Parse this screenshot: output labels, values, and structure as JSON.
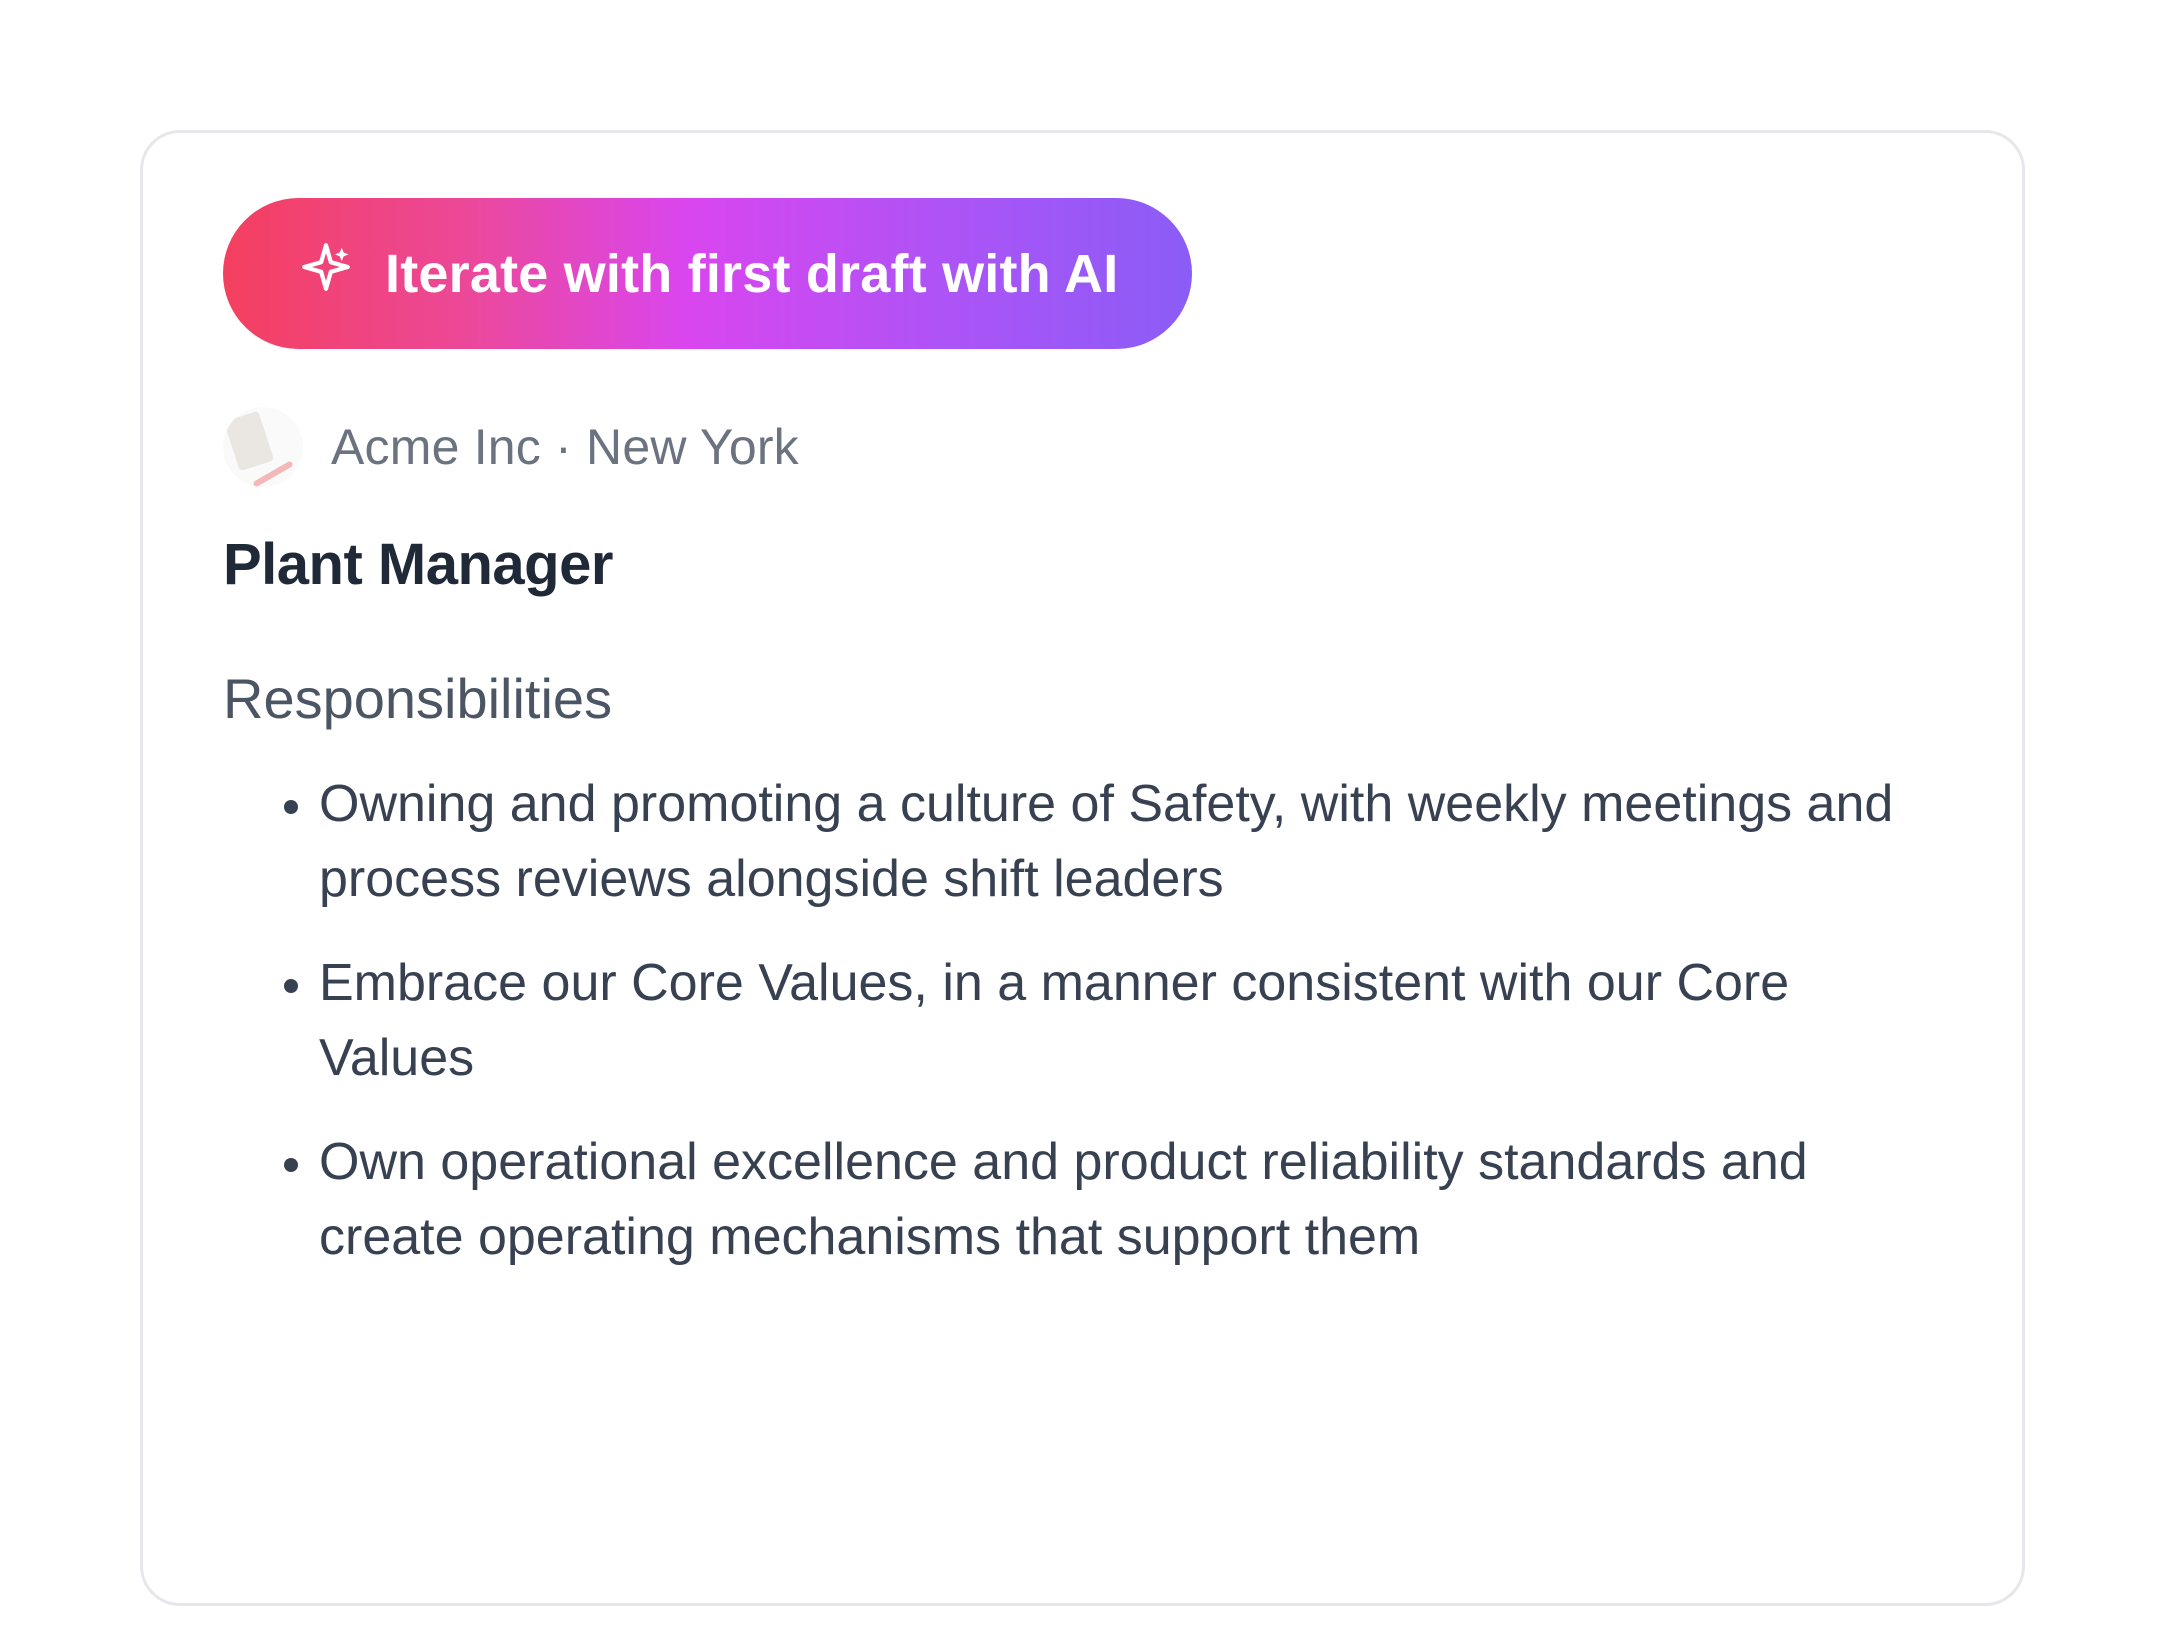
{
  "ai_button": {
    "label": "Iterate with first draft with AI",
    "icon": "sparkle-icon"
  },
  "company": {
    "name": "Acme Inc",
    "location": "New York",
    "separator": " · "
  },
  "job": {
    "title": "Plant Manager",
    "section_heading": "Responsibilities",
    "responsibilities": [
      "Owning and promoting a culture of Safety, with weekly meetings and process reviews alongside shift leaders",
      "Embrace our Core Values,  in a manner consistent with our Core Values",
      "Own operational excellence and product reliability standards and create operating mechanisms that support them"
    ]
  },
  "colors": {
    "gradient_start": "#f43f5e",
    "gradient_end": "#8b5cf6",
    "text_heading": "#1f2937",
    "text_body": "#374151",
    "text_muted": "#6b7280",
    "card_border": "#e5e7eb"
  }
}
